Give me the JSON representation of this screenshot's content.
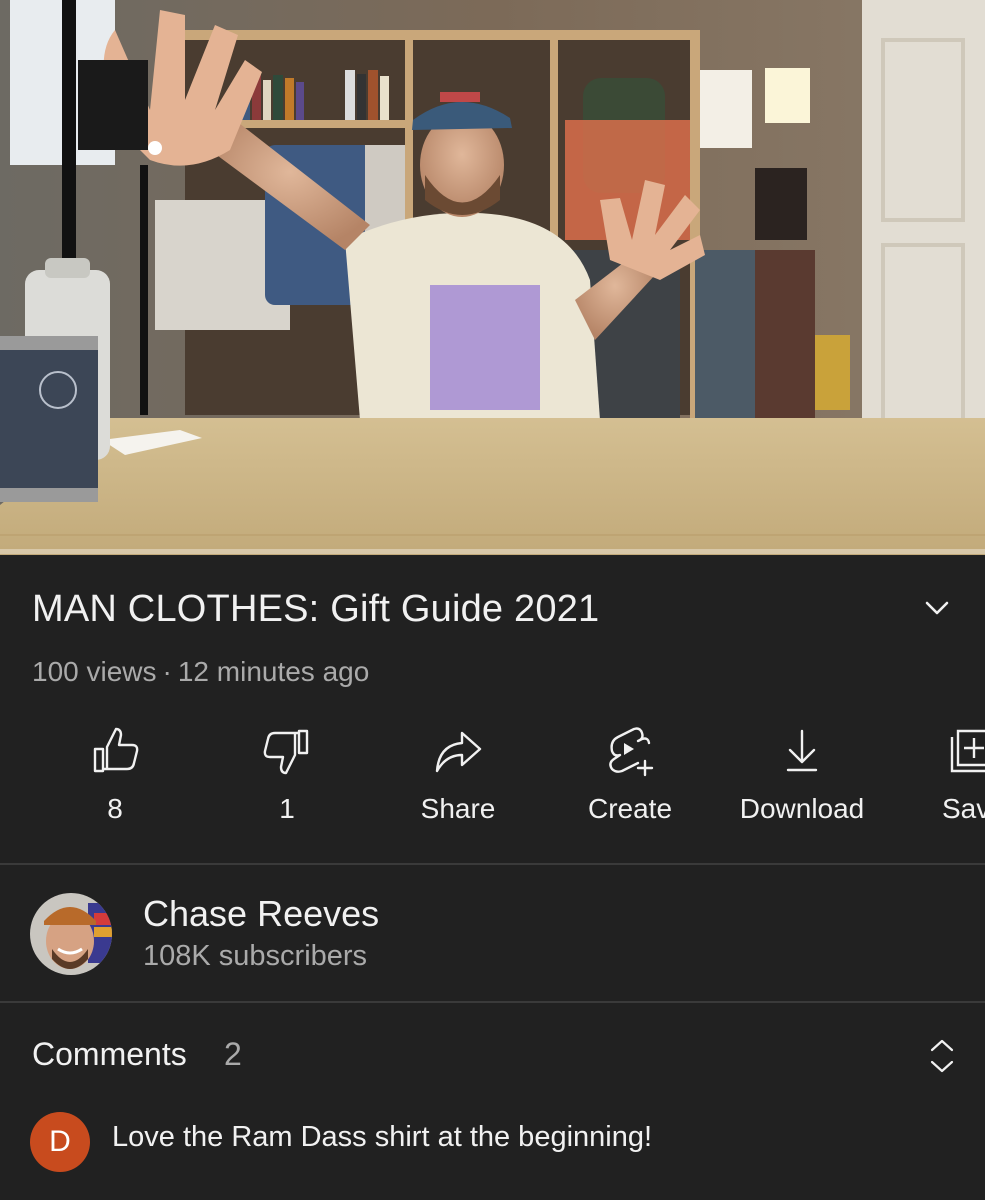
{
  "video": {
    "title": "MAN CLOTHES: Gift Guide 2021",
    "views": "100 views",
    "separator": "·",
    "age": "12 minutes ago",
    "progress_fraction": 0.0
  },
  "actions": {
    "like_count": "8",
    "dislike_count": "1",
    "share_label": "Share",
    "create_label": "Create",
    "download_label": "Download",
    "save_label": "Save"
  },
  "channel": {
    "name": "Chase Reeves",
    "subscribers": "108K subscribers"
  },
  "comments": {
    "label": "Comments",
    "count": "2",
    "top_comment": {
      "avatar_letter": "D",
      "avatar_color": "#c84b1e",
      "text": "Love the Ram Dass shirt at the beginning!"
    }
  },
  "icons": [
    "expand-chevron-icon",
    "thumbs-up-icon",
    "thumbs-down-icon",
    "share-icon",
    "create-icon",
    "download-icon",
    "save-playlist-icon",
    "sort-icon"
  ],
  "colors": {
    "background": "#212121",
    "secondary_text": "#aaaaaa",
    "divider": "#3a3a3a"
  }
}
